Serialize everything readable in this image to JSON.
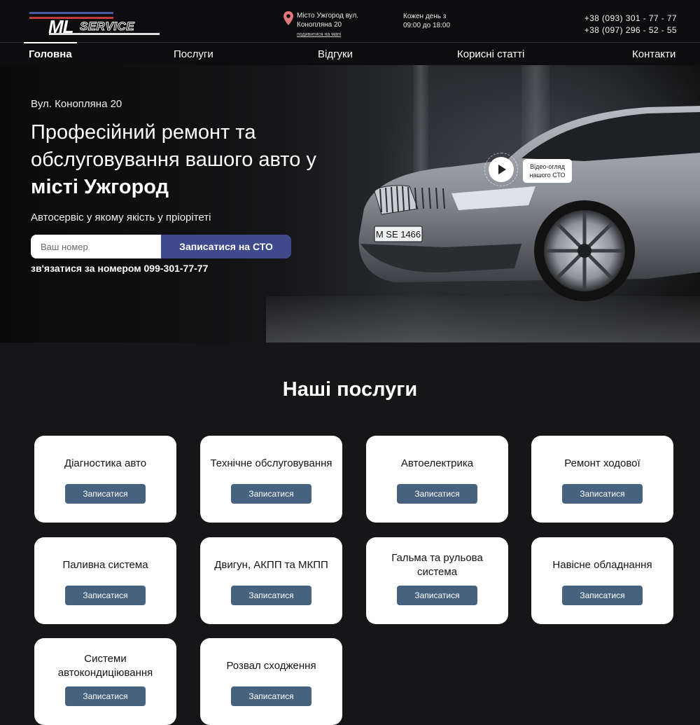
{
  "header": {
    "logo": {
      "ml": "ML",
      "service": "SERVICE"
    },
    "address": {
      "line1": "Місто Ужгород вул.",
      "line2": "Конопляна 20",
      "map_link": "подивитися на мапі"
    },
    "hours": {
      "line1": "Кожен день з",
      "line2": "09:00 до 18:00"
    },
    "phones": [
      "+38 (093) 301 - 77 - 77",
      "+38 (097) 296 - 52 - 55"
    ]
  },
  "nav": {
    "items": [
      "Головна",
      "Послуги",
      "Відгуки",
      "Корисні статті",
      "Контакти"
    ],
    "active": "Головна"
  },
  "hero": {
    "address": "Вул. Конопляна 20",
    "title_regular": "Професійний ремонт та обслуговування вашого авто у",
    "title_bold": "місті Ужгород",
    "subtitle": "Автосервіс у якому якість у пріорітеті",
    "input_placeholder": "Ваш номер",
    "button": "Записатися на СТО",
    "call_text": "зв'язатися за номером 099-301-77-77",
    "video_label": "Відео-огляд нашого СТО",
    "plate": "M SE 1466"
  },
  "services": {
    "title": "Наші послуги",
    "button_label": "Записатися",
    "items": [
      "Діагностика авто",
      "Технічне обслуговування",
      "Автоелектрика",
      "Ремонт ходової",
      "Паливна система",
      "Двигун, АКПП та МКПП",
      "Гальма та рульова система",
      "Навісне обладнання",
      "Системи автокондиціювання",
      "Розвал сходження"
    ]
  }
}
